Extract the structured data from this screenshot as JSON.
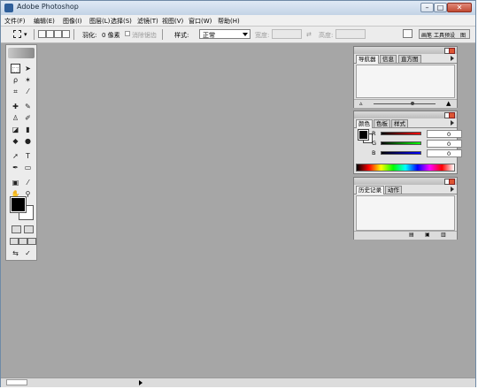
{
  "window": {
    "title": "Adobe Photoshop"
  },
  "menu": [
    "文件(F)",
    "编辑(E)",
    "图像(I)",
    "图层(L)",
    "选择(S)",
    "滤镜(T)",
    "视图(V)",
    "窗口(W)",
    "帮助(H)"
  ],
  "options": {
    "feather_label": "羽化:",
    "feather_value": "0 像素",
    "antialias_label": "消除锯齿",
    "style_label": "样式:",
    "style_value": "正常",
    "width_label": "宽度:",
    "height_label": "高度:",
    "palette_tab_a": "画笔",
    "palette_tab_b": "工具预设",
    "palette_tab_c": "图"
  },
  "palettes": {
    "navigator_tabs": [
      "导航器",
      "信息",
      "直方图"
    ],
    "color_tabs": [
      "颜色",
      "色板",
      "样式"
    ],
    "history_tabs": [
      "历史记录",
      "动作"
    ],
    "channels": [
      {
        "name": "R",
        "value": "0",
        "color_from": "#000000",
        "color_to": "#ff0000"
      },
      {
        "name": "G",
        "value": "0",
        "color_from": "#000000",
        "color_to": "#00ff00"
      },
      {
        "name": "B",
        "value": "0",
        "color_from": "#000000",
        "color_to": "#0000ff"
      }
    ]
  },
  "colors": {
    "workspace": "#a6a6a6",
    "foreground": "#000000",
    "background": "#ffffff"
  }
}
